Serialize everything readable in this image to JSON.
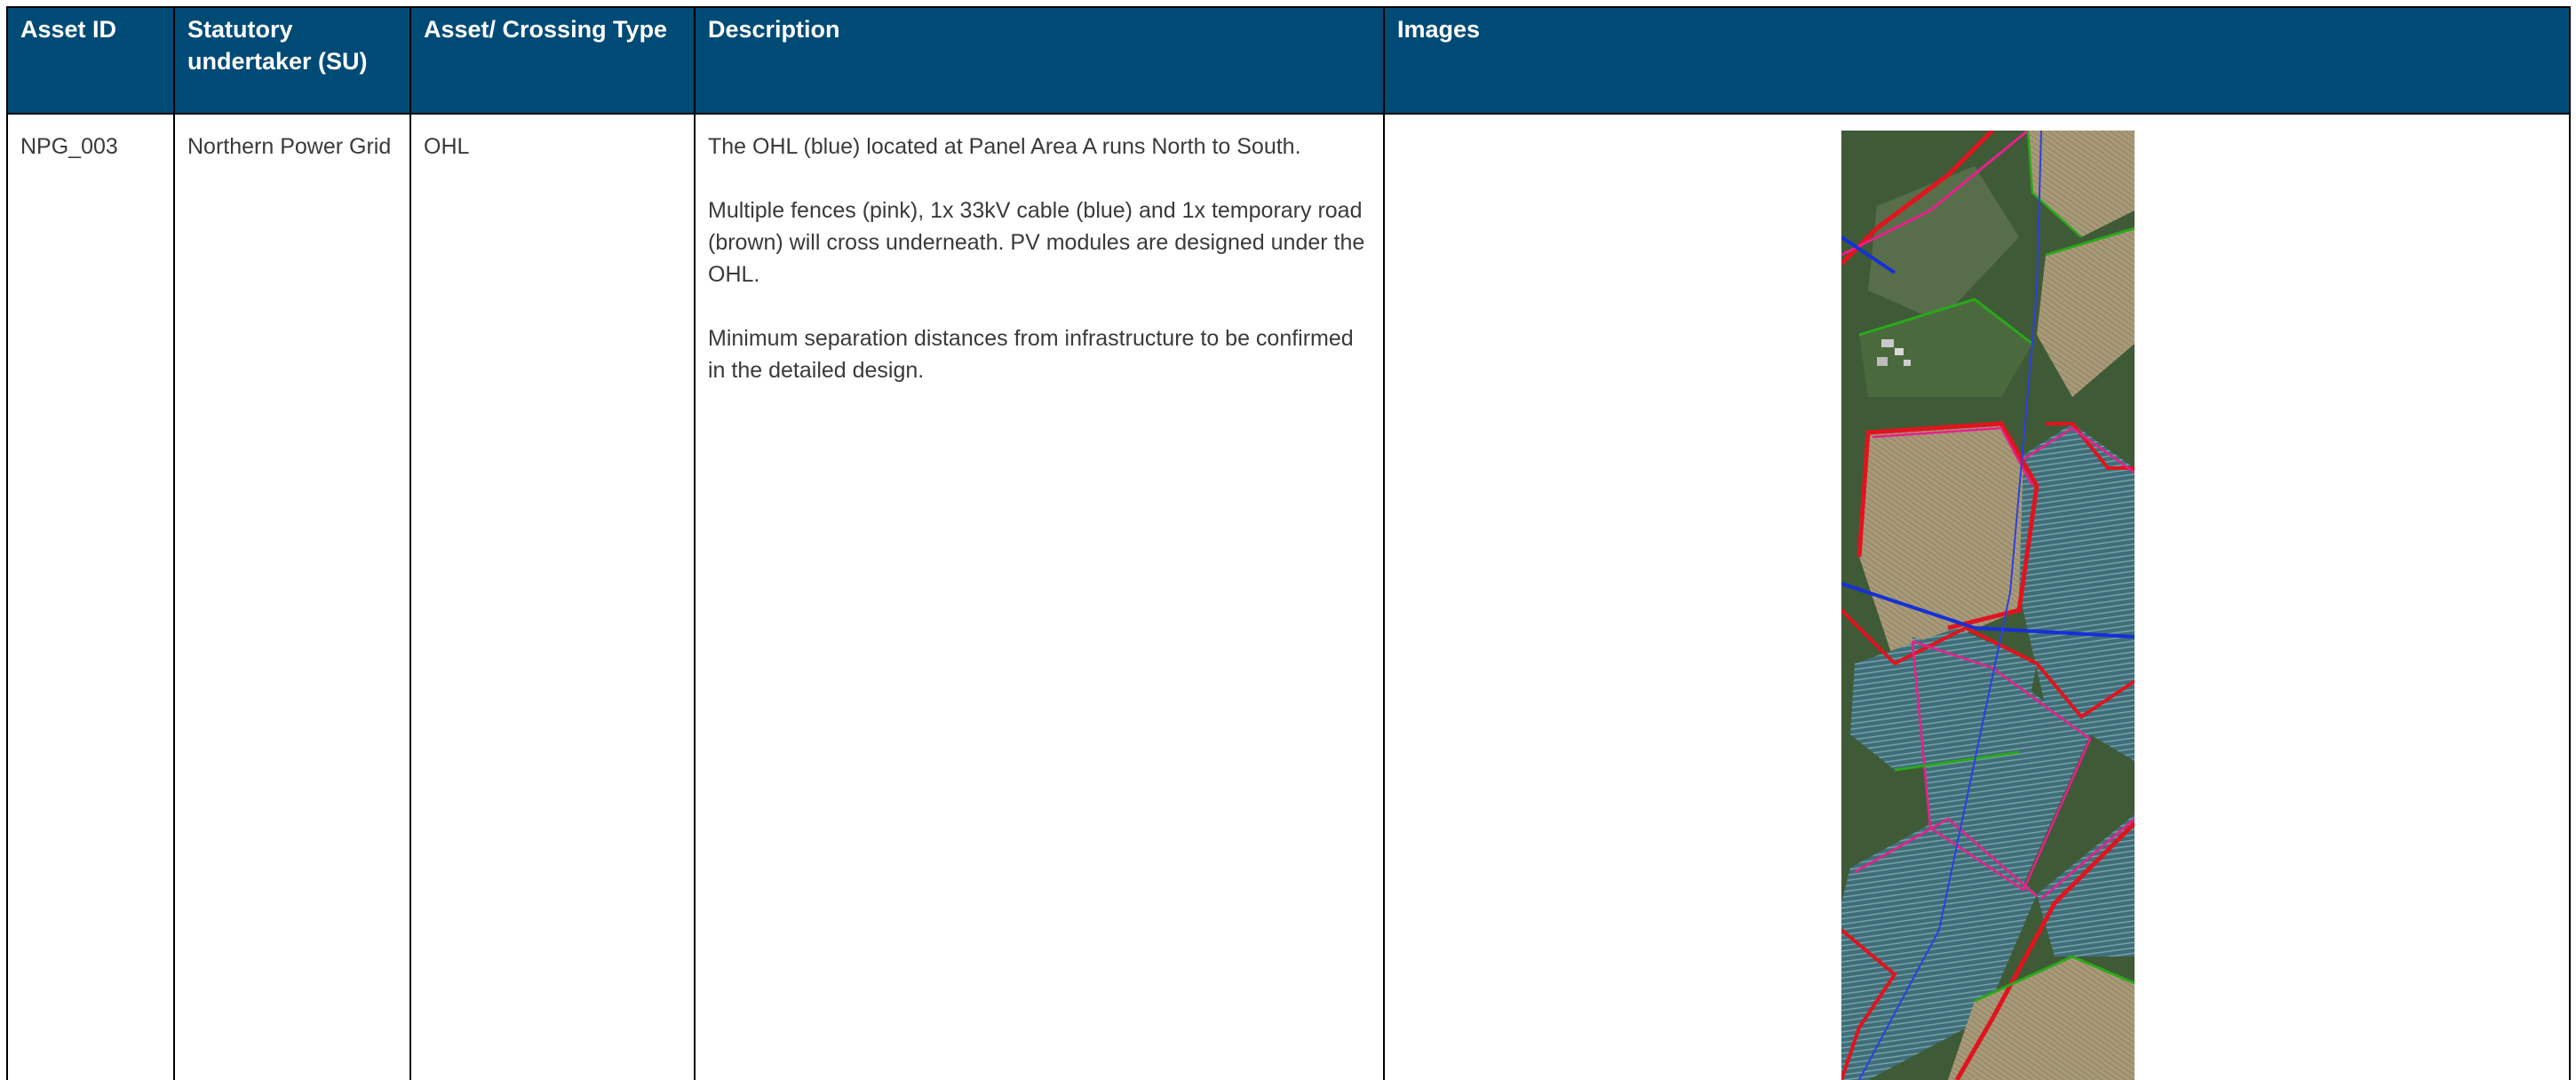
{
  "table": {
    "headers": [
      "Asset ID",
      "Statutory undertaker (SU)",
      "Asset/ Crossing Type",
      "Description",
      "Images"
    ],
    "rows": [
      {
        "asset_id": "NPG_003",
        "statutory_undertaker": "Northern Power Grid",
        "crossing_type": "OHL",
        "description": [
          "The OHL (blue) located at Panel Area A runs North to South.",
          "Multiple fences (pink), 1x 33kV cable (blue) and 1x temporary road (brown) will cross underneath. PV modules are designed under the OHL.",
          "Minimum separation distances from infrastructure to be confirmed in the detailed design."
        ]
      }
    ]
  },
  "colors": {
    "header_background": "#004a76",
    "header_text": "#ffffff",
    "body_text": "#3a3a3a",
    "ohl_line": "#2f3fe0",
    "cable_line": "#1530d8",
    "fence_line": "#e8208c",
    "boundary_line": "#e0141e",
    "hedge_line": "#2aa81a"
  },
  "image": {
    "icon": "aerial-map-image"
  }
}
